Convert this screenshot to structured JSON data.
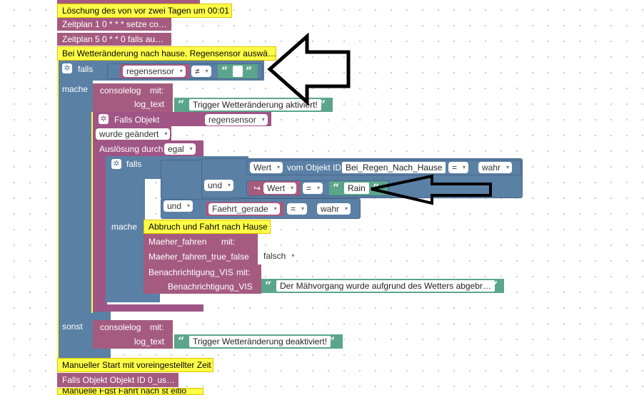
{
  "colors": {
    "logic": "#5b80a5",
    "procedure": "#a55b80",
    "text": "#5ba58c",
    "comment": "#ffff46",
    "arrow": "#000000"
  },
  "comments": {
    "c1": "Löschung des von vor zwei Tagen um 00:01",
    "c2": "Bei Wetteränderung nach hause. Regensensor auswä…",
    "c3": "Abbruch und Fahrt nach Hause",
    "c4": "Manueller Start mit voreingestellter Zeit",
    "c5": "Manuelle Fgst Fahrt nach st eitlo"
  },
  "schedules": {
    "s1": "Zeitplan 1 0 * * * setze co…",
    "s2": "Zeitplan 5 0 * * 0 falls au…",
    "s3": "Falls Objekt Objekt ID 0_us…"
  },
  "outer_if": {
    "falls": "falls",
    "mache": "mache",
    "sonst": "sonst",
    "var": "regensensor",
    "op": "≠",
    "text_value": "",
    "icon": "gear-icon"
  },
  "consolelog1": {
    "label": "consolelog",
    "mit": "mit:",
    "param": "log_text",
    "value": "Trigger Wetteränderung aktiviert!"
  },
  "trigger": {
    "title": "Falls Objekt",
    "object": "regensensor",
    "mode": "wurde geändert",
    "ausl_label": "Auslösung durch",
    "ausl_value": "egal"
  },
  "inner_if": {
    "falls": "falls",
    "mache": "mache",
    "und1": "und",
    "und2": "und",
    "cond1": {
      "wert": "Wert",
      "vom": "vom Objekt ID",
      "obj": "Bei_Regen_Nach_Hause",
      "op": "=",
      "val": "wahr"
    },
    "cond2": {
      "wert": "Wert",
      "op": "=",
      "val": "Rain"
    },
    "cond3": {
      "var": "Faehrt_gerade",
      "op": "=",
      "val": "wahr"
    }
  },
  "maeher": {
    "label": "Maeher_fahren",
    "mit": "mit:",
    "param": "Maeher_fahren_true_false",
    "value": "falsch"
  },
  "benach": {
    "label": "Benachrichtigung_VIS",
    "mit": "mit:",
    "param": "Benachrichtigung_VIS",
    "value": "Der Mähvorgang wurde aufgrund des Wetters abgebr…"
  },
  "consolelog2": {
    "label": "consolelog",
    "mit": "mit:",
    "param": "log_text",
    "value": "Trigger Wetteränderung deaktiviert!"
  },
  "glyphs": {
    "open_quote": "“",
    "close_quote": "”",
    "dropdown": "▾",
    "link": "↪"
  }
}
